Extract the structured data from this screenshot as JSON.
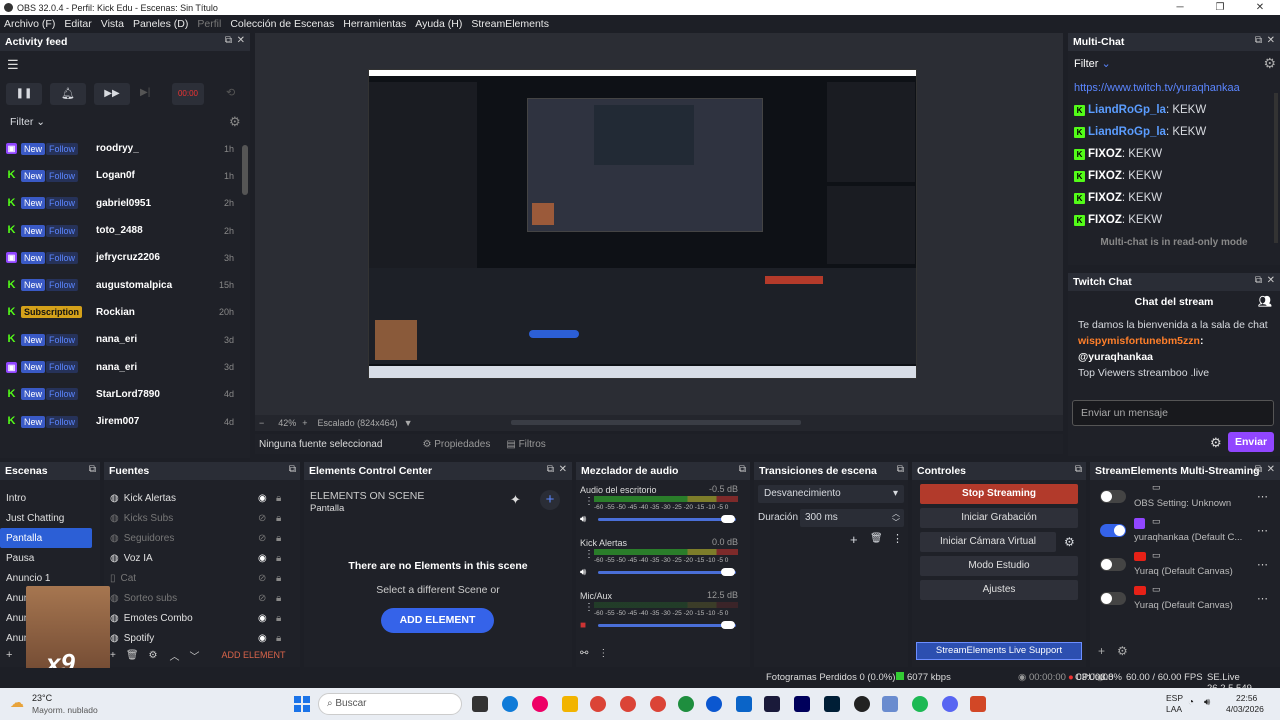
{
  "window": {
    "title": "OBS 32.0.4 - Perfil: Kick Edu - Escenas: Sin Título"
  },
  "menu": [
    "Archivo (F)",
    "Editar",
    "Vista",
    "Paneles (D)",
    "Perfil",
    "Colección de Escenas",
    "Herramientas",
    "Ayuda (H)",
    "StreamElements"
  ],
  "activity": {
    "title": "Activity feed",
    "filter_label": "Filter",
    "timer": "00:00",
    "new_label": "New",
    "follow_label": "Follow",
    "items": [
      {
        "platform": "twitch",
        "type": "follow",
        "user": "roodryy_",
        "time": "1h"
      },
      {
        "platform": "kick",
        "type": "follow",
        "user": "Logan0f",
        "time": "1h"
      },
      {
        "platform": "kick",
        "type": "follow",
        "user": "gabriel0951",
        "time": "2h"
      },
      {
        "platform": "kick",
        "type": "follow",
        "user": "toto_2488",
        "time": "2h"
      },
      {
        "platform": "twitch",
        "type": "follow",
        "user": "jefrycruz2206",
        "time": "3h"
      },
      {
        "platform": "kick",
        "type": "follow",
        "user": "augustomalpica",
        "time": "15h"
      },
      {
        "platform": "kick",
        "type": "subscription",
        "label": "Subscription",
        "user": "Rockian",
        "time": "20h"
      },
      {
        "platform": "kick",
        "type": "follow",
        "user": "nana_eri",
        "time": "3d"
      },
      {
        "platform": "twitch",
        "type": "follow",
        "user": "nana_eri",
        "time": "3d"
      },
      {
        "platform": "kick",
        "type": "follow",
        "user": "StarLord7890",
        "time": "4d"
      },
      {
        "platform": "kick",
        "type": "follow",
        "user": "Jirem007",
        "time": "4d"
      }
    ]
  },
  "preview": {
    "zoom": "42%",
    "scale": "Escalado (824x464)"
  },
  "source_bar": {
    "none": "Ninguna fuente seleccionad",
    "props": "Propiedades",
    "filters": "Filtros"
  },
  "multichat": {
    "title": "Multi-Chat",
    "filter_label": "Filter",
    "link": "https://www.twitch.tv/yuraqhankaa",
    "messages": [
      {
        "user": "LiandRoGp_la",
        "text": ": KEKW",
        "color": "#5b9dff"
      },
      {
        "user": "LiandRoGp_la",
        "text": ": KEKW",
        "color": "#5b9dff"
      },
      {
        "user": "FIXOZ",
        "text": ": KEKW",
        "color": "#ffffff"
      },
      {
        "user": "FIXOZ",
        "text": ": KEKW",
        "color": "#ffffff"
      },
      {
        "user": "FIXOZ",
        "text": ": KEKW",
        "color": "#ffffff"
      },
      {
        "user": "FIXOZ",
        "text": ": KEKW",
        "color": "#ffffff"
      }
    ],
    "readonly": "Multi-chat is in read-only mode"
  },
  "twitch_chat": {
    "title": "Twitch Chat",
    "header": "Chat del stream",
    "welcome": "Te damos la bienvenida a la sala de chat",
    "msg_user": "wispymisfortunebm5zzn",
    "msg_mention": ": @yuraqhankaa",
    "msg2": "Top Viewers streamboo .live",
    "input_placeholder": "Enviar un mensaje",
    "send": "Enviar"
  },
  "scenes": {
    "title": "Escenas",
    "items": [
      "Intro",
      "Just Chatting",
      "Pantalla",
      "Pausa",
      "Anuncio 1",
      "Anuncio 2",
      "Anuncio 3",
      "Anuncio 4"
    ],
    "selected": 2
  },
  "sources": {
    "title": "Fuentes",
    "items": [
      {
        "name": "Kick Alertas",
        "visible": true,
        "icon": "globe-icon"
      },
      {
        "name": "Kicks Subs",
        "visible": false,
        "icon": "globe-icon"
      },
      {
        "name": "Seguidores",
        "visible": false,
        "icon": "globe-icon"
      },
      {
        "name": "Voz IA",
        "visible": true,
        "icon": "globe-icon"
      },
      {
        "name": "Cat",
        "visible": false,
        "icon": "file-icon"
      },
      {
        "name": "Sorteo subs",
        "visible": false,
        "icon": "globe-icon"
      },
      {
        "name": "Emotes Combo",
        "visible": true,
        "icon": "globe-icon"
      },
      {
        "name": "Spotify",
        "visible": true,
        "icon": "globe-icon"
      }
    ],
    "add_element": "ADD ELEMENT"
  },
  "ecc": {
    "title": "Elements Control Center",
    "heading": "ELEMENTS ON SCENE",
    "scene": "Pantalla",
    "empty": "There are no Elements in this scene",
    "sub": "Select a different Scene or",
    "button": "ADD ELEMENT"
  },
  "mixer": {
    "title": "Mezclador de audio",
    "channels": [
      {
        "name": "Audio del escritorio",
        "db": "-0.5 dB",
        "level": 0.9
      },
      {
        "name": "Kick Alertas",
        "db": "0.0 dB",
        "level": 0.92
      },
      {
        "name": "Mic/Aux",
        "db": "12.5 dB",
        "level": 0.0
      }
    ],
    "scale": "-60 -55 -50 -45 -40 -35 -30 -25 -20 -15 -10 -5 0"
  },
  "transitions": {
    "title": "Transiciones de escena",
    "type": "Desvanecimiento",
    "duration_label": "Duración",
    "duration": "300 ms"
  },
  "controls": {
    "title": "Controles",
    "stop": "Stop Streaming",
    "record": "Iniciar Grabación",
    "vcam": "Iniciar Cámara Virtual",
    "studio": "Modo Estudio",
    "settings": "Ajustes",
    "support": "StreamElements Live Support"
  },
  "multistream": {
    "title": "StreamElements Multi-Streaming",
    "rows": [
      {
        "label": "OBS Setting: Unknown",
        "on": false,
        "platform": "none"
      },
      {
        "label": "yuraqhankaa (Default C...",
        "on": true,
        "platform": "twitch"
      },
      {
        "label": "Yuraq (Default Canvas)",
        "on": false,
        "platform": "youtube"
      },
      {
        "label": "Yuraq (Default Canvas)",
        "on": false,
        "platform": "youtube"
      }
    ]
  },
  "status": {
    "dropped": "Fotogramas Perdidos 0 (0.0%)",
    "bitrate": "6077 kbps",
    "rec_time": "00:00:00",
    "live_time": "03:00:08",
    "cpu": "CPU: 3.0%",
    "fps": "60.00 / 60.00 FPS",
    "version": "SE.Live 26.2.5.549"
  },
  "taskbar": {
    "weather_temp": "23°C",
    "weather_desc": "Mayorm. nublado",
    "search": "Buscar",
    "lang": "ESP",
    "lang2": "LAA",
    "time": "22:56",
    "date": "4/03/2026"
  },
  "colors": {
    "accent": "#2c5fd6",
    "stop": "#c0392b",
    "kick": "#53fc18",
    "twitch": "#9146ff"
  }
}
